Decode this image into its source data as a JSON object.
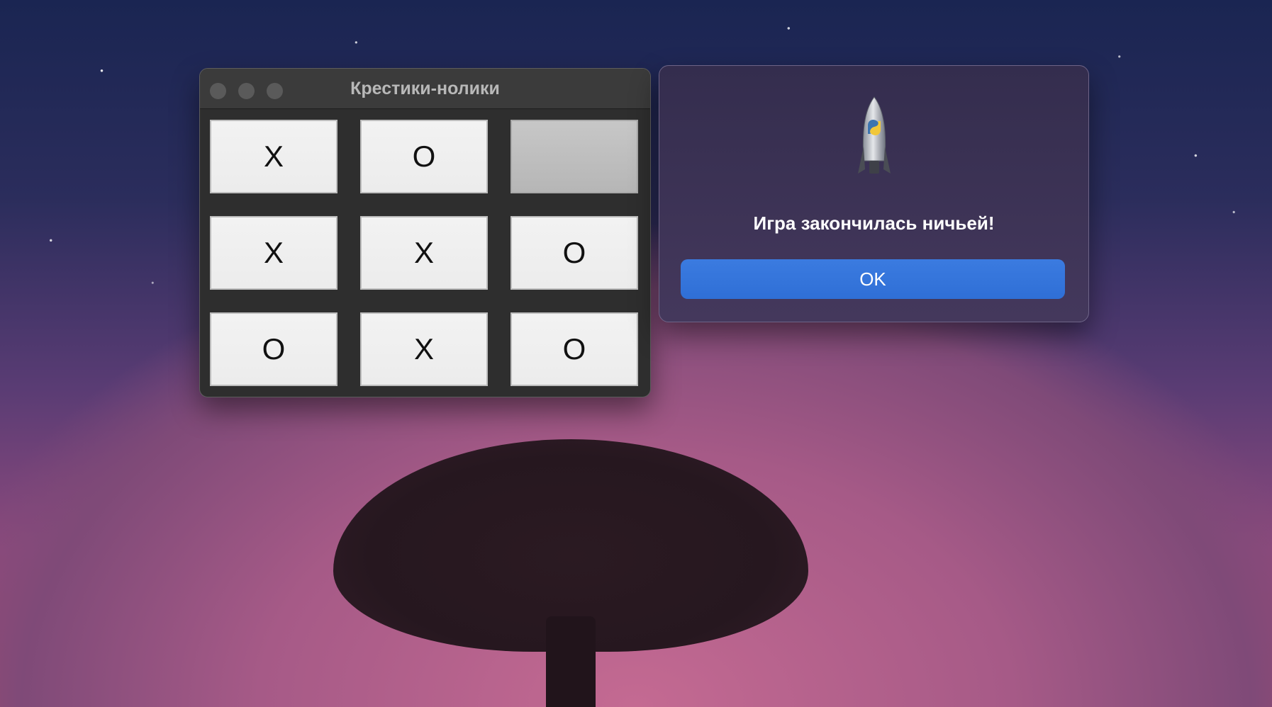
{
  "window": {
    "title": "Крестики-нолики",
    "board": [
      {
        "mark": "X"
      },
      {
        "mark": "O"
      },
      {
        "mark": ""
      },
      {
        "mark": "X"
      },
      {
        "mark": "X"
      },
      {
        "mark": "O"
      },
      {
        "mark": "O"
      },
      {
        "mark": "X"
      },
      {
        "mark": "O"
      }
    ]
  },
  "dialog": {
    "icon": "python-rocket-icon",
    "message": "Игра закончилась ничьей!",
    "ok_label": "OK"
  },
  "colors": {
    "button_accent": "#2f6fd6",
    "window_bg": "#2e2e2e",
    "dialog_bg": "#3b3356"
  }
}
